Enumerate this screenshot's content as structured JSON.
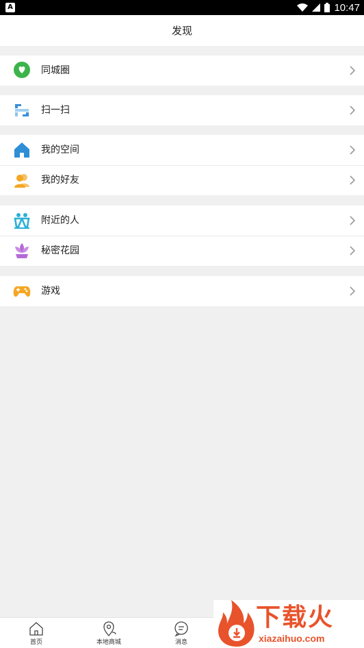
{
  "status_bar": {
    "time": "10:47",
    "left_icon": "A"
  },
  "header": {
    "title": "发现"
  },
  "groups": [
    {
      "items": [
        {
          "label": "同城圈",
          "icon": "chat-heart-icon",
          "color": "#3cb44a"
        }
      ]
    },
    {
      "items": [
        {
          "label": "扫一扫",
          "icon": "scan-icon",
          "color": "#3a8fd8"
        }
      ]
    },
    {
      "items": [
        {
          "label": "我的空间",
          "icon": "home-icon",
          "color": "#2e8ed6"
        },
        {
          "label": "我的好友",
          "icon": "friends-icon",
          "color": "#f5a623"
        }
      ]
    },
    {
      "items": [
        {
          "label": "附近的人",
          "icon": "nearby-people-icon",
          "color": "#2bb0d6"
        },
        {
          "label": "秘密花园",
          "icon": "lotus-icon",
          "color": "#b56ad6"
        }
      ]
    },
    {
      "items": [
        {
          "label": "游戏",
          "icon": "gamepad-icon",
          "color": "#f5a623"
        }
      ]
    }
  ],
  "bottom_nav": [
    {
      "label": "首页",
      "icon": "home-outline-icon"
    },
    {
      "label": "本地商城",
      "icon": "map-pin-icon"
    },
    {
      "label": "消息",
      "icon": "message-icon"
    }
  ],
  "watermark": {
    "brand": "下载火",
    "url": "xiazaihuo.com",
    "color": "#e8532b"
  }
}
